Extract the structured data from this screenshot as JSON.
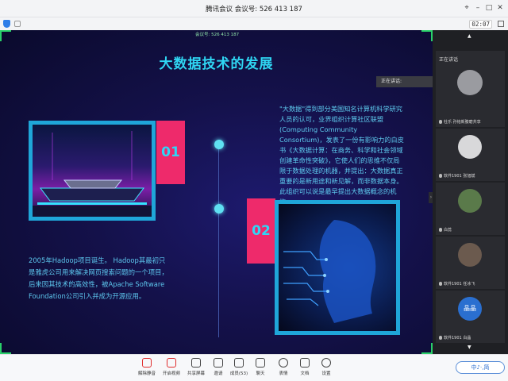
{
  "window": {
    "title": "腾讯会议  会议号:  526 413 187",
    "clock": "02:07",
    "meeting_badge": "会议号: 526 413 187"
  },
  "slide": {
    "title": "大数据技术的发展",
    "number_1": "01",
    "number_2": "02",
    "text_right": "\"大数据\"得到部分美国知名计算机科学研究人员的认可，业界组织计算社区联盟(Computing Community Consortium)，发表了一份有影响力的白皮书《大数据计算：在商务、科学和社会领域创建革命性突破》，它使人们的思维不仅局限于数据处理的机器，并提出：大数据真正重要的是新用途和新见解，而非数据本身。此组织可以说是最早提出大数据概念的机构。",
    "text_left": "2005年Hadoop项目诞生。 Hadoop其最初只是雅虎公司用来解决网页搜索问题的一个项目，后来因其技术的高效性，被Apache Software Foundation公司引入并成为开源应用。",
    "accent_color": "#2fd6f3",
    "number_box_color": "#ee2a6b"
  },
  "speaking": {
    "tag": "正在讲话:"
  },
  "gallery": {
    "main_tab": "正在讲话",
    "participants": [
      {
        "name": "杜乐 孙铭新膀磨共享"
      },
      {
        "name": "软件1901 张旭斌"
      },
      {
        "name": "白蕊"
      },
      {
        "name": "软件1901 任冰飞"
      },
      {
        "name": "软件1901 白晶"
      }
    ],
    "text_avatar": "晶晶"
  },
  "toolbar": {
    "items": [
      {
        "label": "解除静音",
        "icon": "mic-muted-icon"
      },
      {
        "label": "开启视频",
        "icon": "video-off-icon"
      },
      {
        "label": "共享屏幕",
        "icon": "share-screen-icon"
      },
      {
        "label": "邀请",
        "icon": "invite-icon"
      },
      {
        "label": "成员(53)",
        "icon": "members-icon"
      },
      {
        "label": "聊天",
        "icon": "chat-icon"
      },
      {
        "label": "表情",
        "icon": "emoji-icon"
      },
      {
        "label": "文档",
        "icon": "document-icon"
      },
      {
        "label": "设置",
        "icon": "settings-icon"
      }
    ],
    "ime_label": "中♪·,简"
  }
}
